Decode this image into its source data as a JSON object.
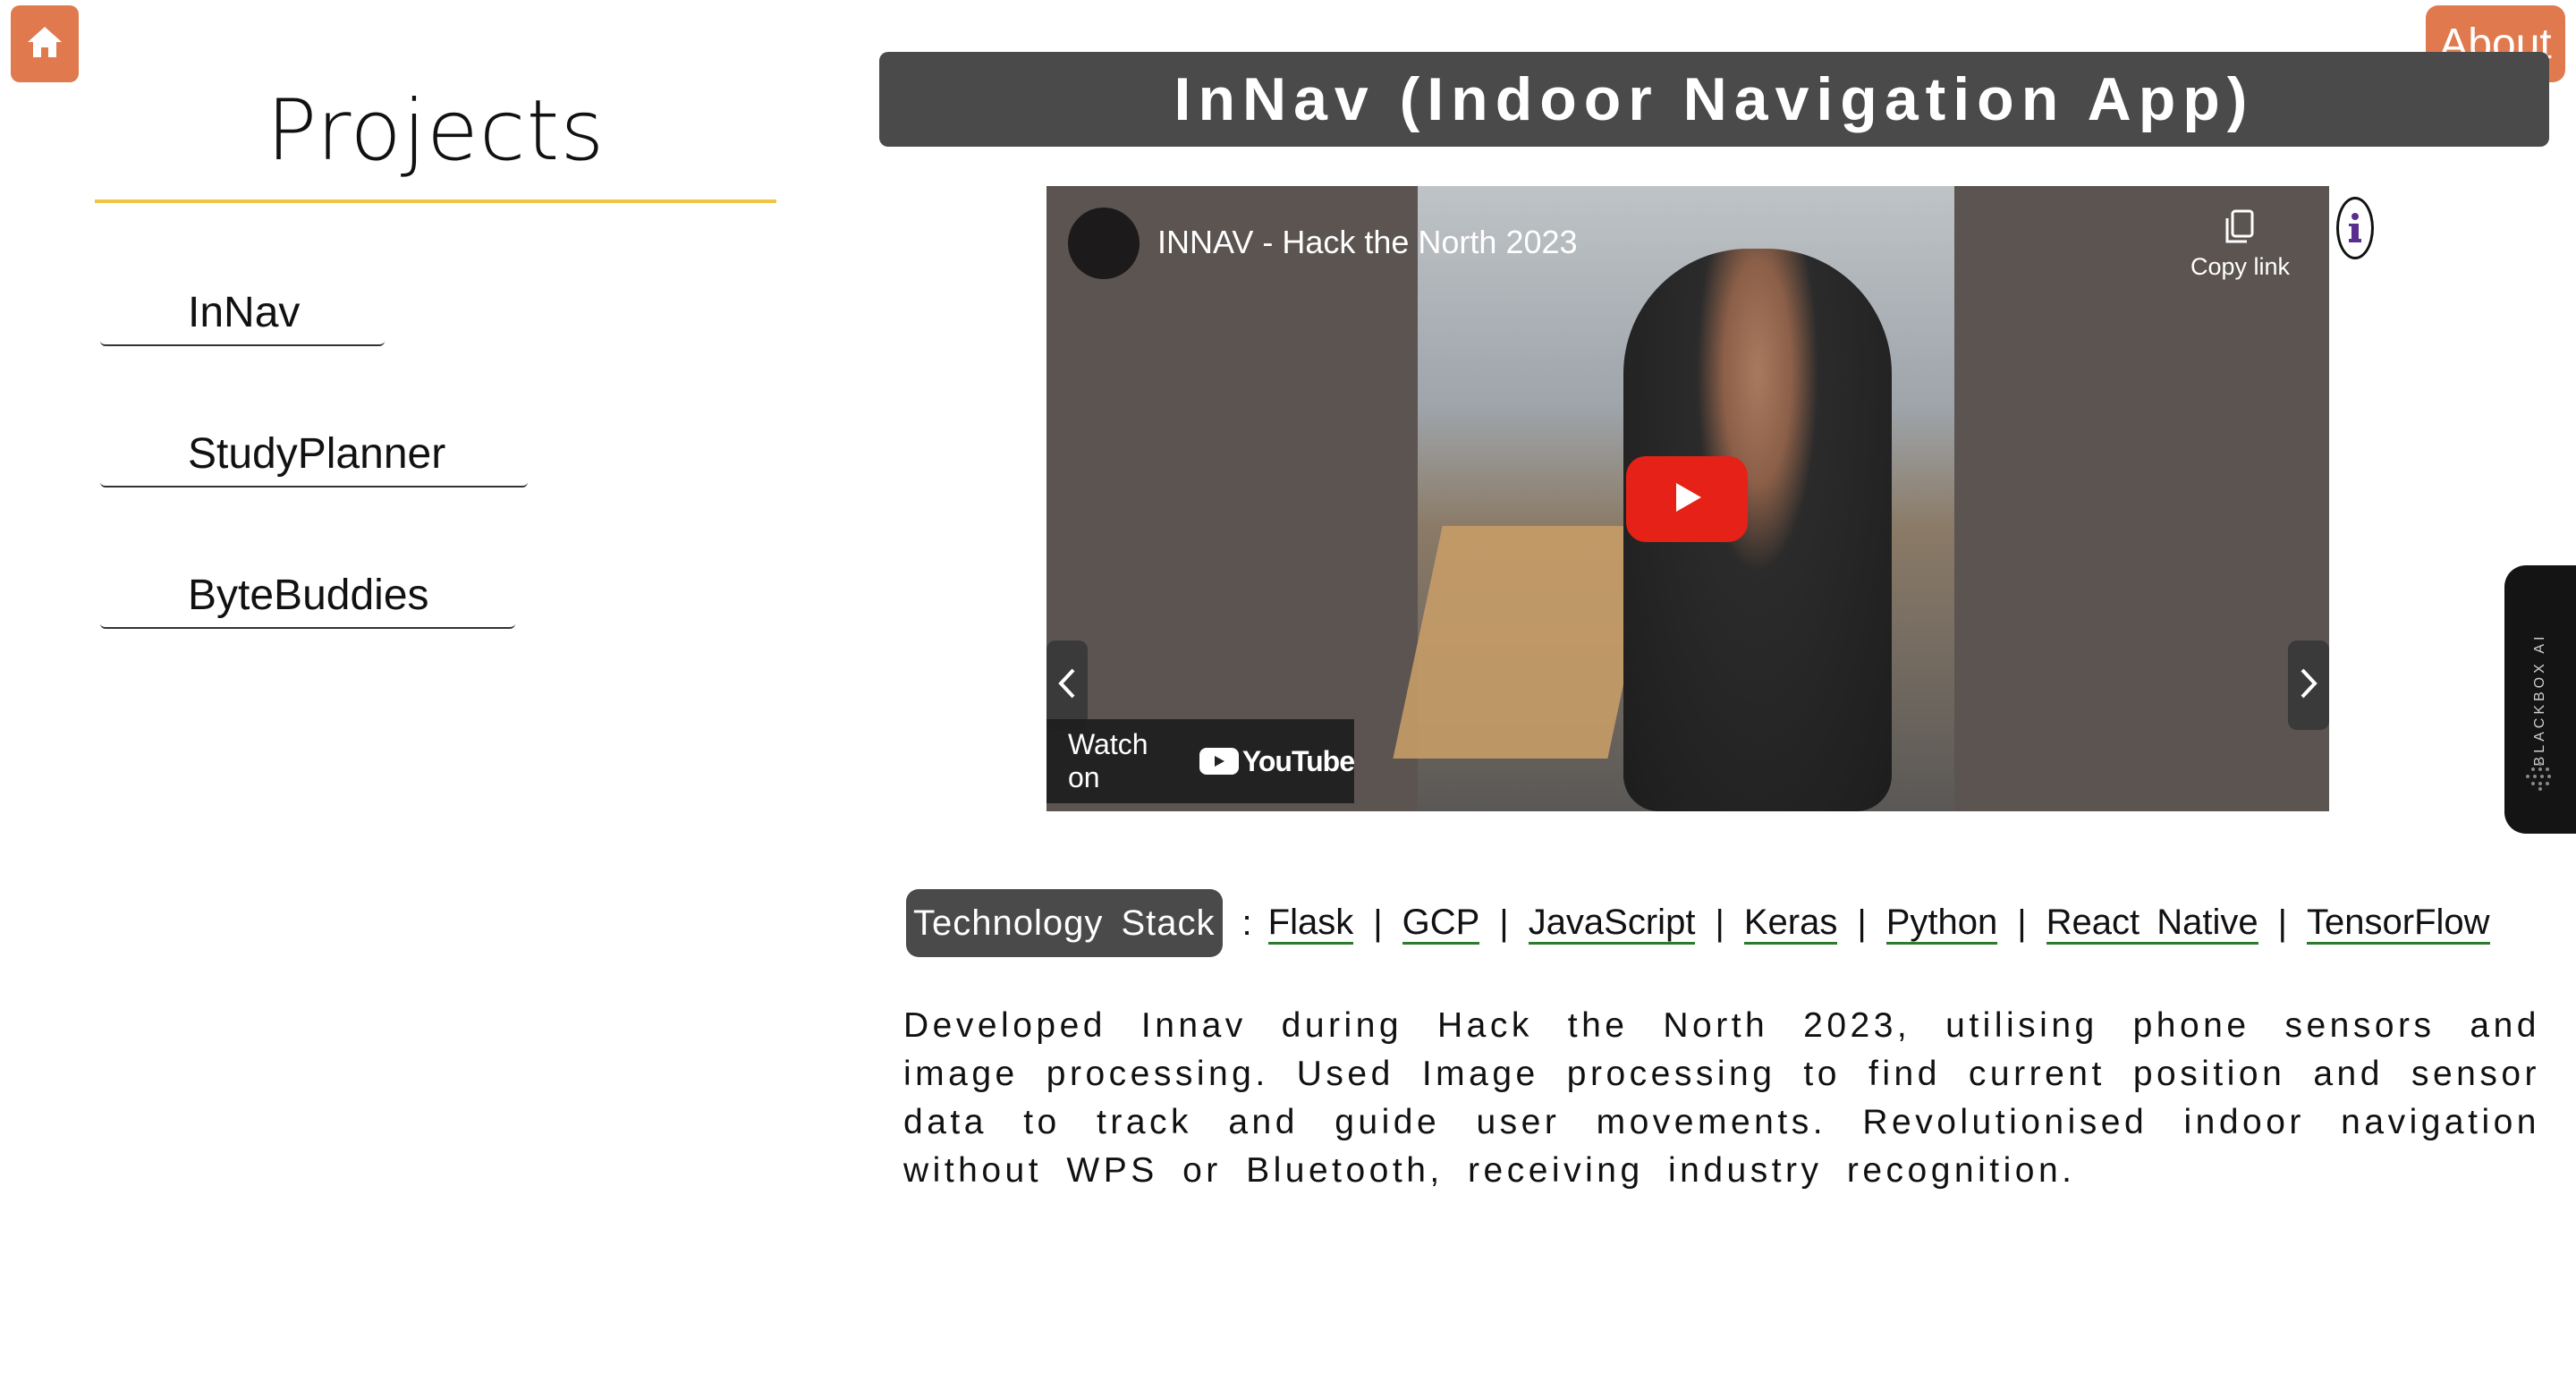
{
  "nav": {
    "about_label": "About"
  },
  "sidebar": {
    "title": "Projects",
    "projects": [
      {
        "label": "InNav"
      },
      {
        "label": "StudyPlanner"
      },
      {
        "label": "ByteBuddies"
      }
    ]
  },
  "main": {
    "title": "InNav (Indoor Navigation App)",
    "video": {
      "title": "INNAV - Hack the North 2023",
      "copy_link_label": "Copy link",
      "watch_on_label": "Watch on",
      "youtube_label": "YouTube"
    },
    "tech_stack": {
      "label": "Technology Stack",
      "colon": ":",
      "separator": "|",
      "items": [
        "Flask",
        "GCP",
        "JavaScript",
        "Keras",
        "Python",
        "React Native",
        "TensorFlow"
      ]
    },
    "description": "Developed Innav during Hack the North 2023, utilising phone sensors and image processing. Used Image processing to find current position and sensor data to track and guide user movements. Revolutionised indoor navigation without WPS or Bluetooth, receiving industry recognition."
  },
  "extension": {
    "label": "BLACKBOX AI"
  },
  "colors": {
    "accent_orange": "#e07a4e",
    "underline_yellow": "#f2c443",
    "title_bar": "#4a4a4a",
    "link_underline": "#2c7a2c",
    "youtube_red": "#e62117"
  }
}
